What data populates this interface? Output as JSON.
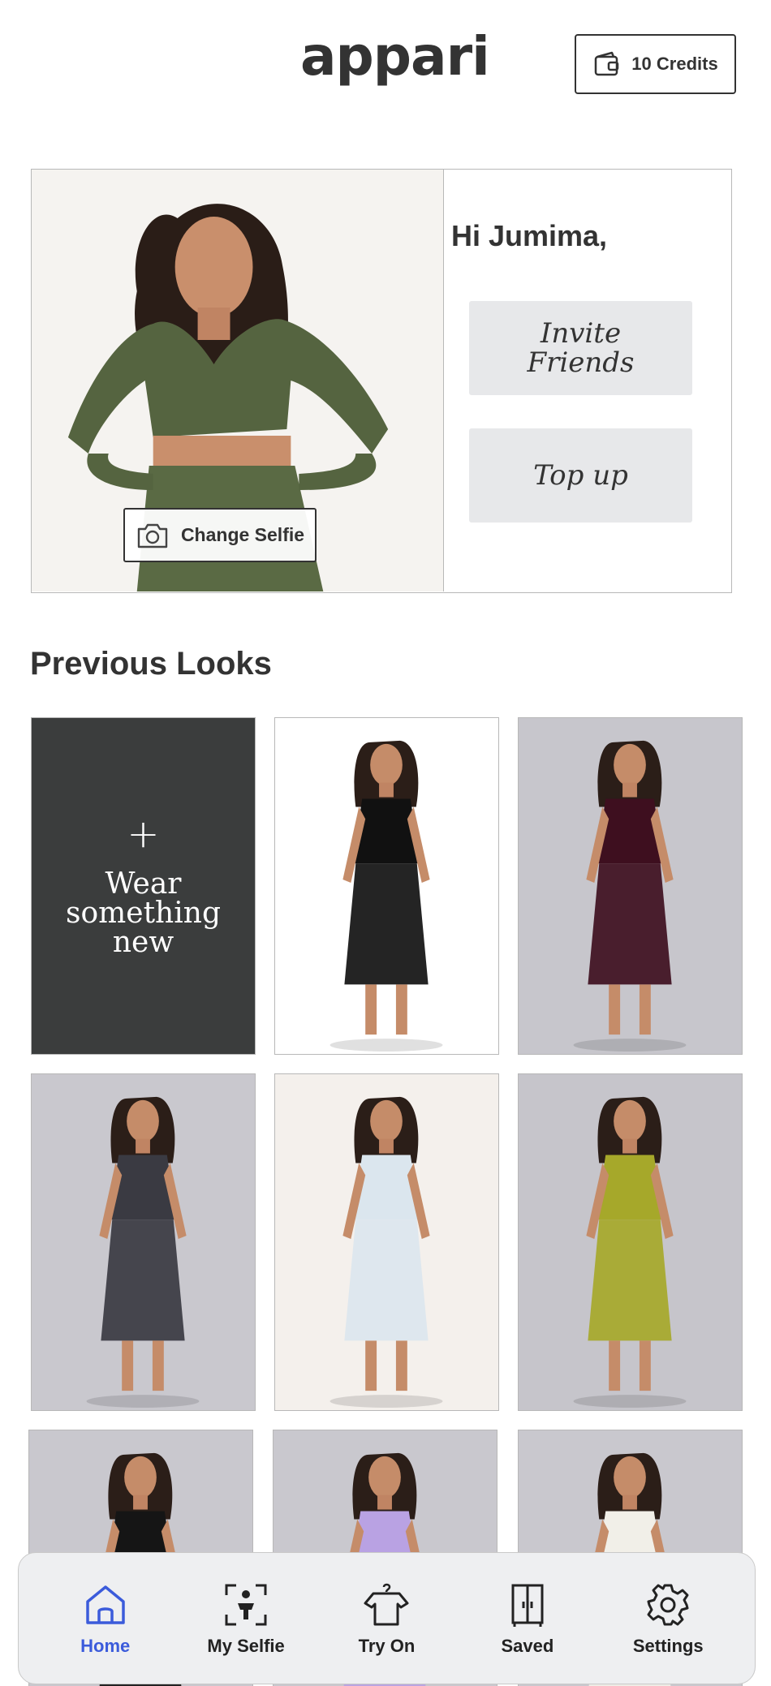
{
  "header": {
    "logo": "appari",
    "credits_label": "10 Credits"
  },
  "profile": {
    "greeting": "Hi Jumima,",
    "change_selfie_label": "Change Selfie",
    "invite_label": "Invite Friends",
    "topup_label": "Top up"
  },
  "previous_looks": {
    "title": "Previous Looks",
    "new_tile_plus": "+",
    "new_tile_label": "Wear something new",
    "looks": [
      {
        "outfit": "black puff-sleeve mini dress",
        "bg": "#ffffff",
        "color": "#111111"
      },
      {
        "outfit": "plum strapless maxi dress",
        "bg": "#c7c6cc",
        "color": "#3e0f1f"
      },
      {
        "outfit": "grey jacket, sports bra and leggings",
        "bg": "#c9c8ce",
        "color": "#3a3a42"
      },
      {
        "outfit": "pale blue strapless tulle midi dress",
        "bg": "#f4f0ec",
        "color": "#dbe6ee"
      },
      {
        "outfit": "chartreuse satin off-shoulder gown",
        "bg": "#c6c5cb",
        "color": "#a6a82a"
      },
      {
        "outfit": "black bralette top",
        "bg": "#c9c8ce",
        "color": "#151515"
      },
      {
        "outfit": "lilac top",
        "bg": "#c9c8ce",
        "color": "#b9a2e3"
      },
      {
        "outfit": "white crop top and cream blazer",
        "bg": "#c9c8ce",
        "color": "#f1efe8"
      }
    ]
  },
  "nav": {
    "items": [
      {
        "label": "Home",
        "icon": "home-icon",
        "active": true
      },
      {
        "label": "My Selfie",
        "icon": "person-scan-icon",
        "active": false
      },
      {
        "label": "Try On",
        "icon": "tshirt-hanger-icon",
        "active": false
      },
      {
        "label": "Saved",
        "icon": "wardrobe-icon",
        "active": false
      },
      {
        "label": "Settings",
        "icon": "gear-icon",
        "active": false
      }
    ]
  },
  "colors": {
    "text": "#333333",
    "accent_blue": "#3b5bdb",
    "button_grey": "#e7e8ea",
    "dark_tile": "#3b3d3d",
    "nav_bg": "#eeeff1",
    "selfie_top": "#4f5e38"
  }
}
